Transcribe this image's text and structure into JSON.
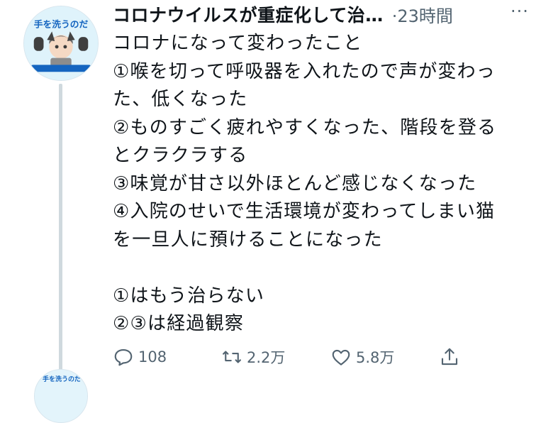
{
  "tweet": {
    "display_name": "コロナウイルスが重症化して治…",
    "time": "·23時間",
    "more_label": "···",
    "lines": [
      "コロナになって変わったこと",
      "①喉を切って呼吸器を入れたので声が変わっ",
      "た、低くなった",
      "②ものすごく疲れやすくなった、階段を登る",
      "とクラクラする",
      "③味覚が甘さ以外ほとんど感じなくなった",
      "④入院のせいで生活環境が変わってしまい猫",
      "を一旦人に預けることになった",
      "",
      "①はもう治らない",
      "②③は経過観察"
    ],
    "avatar_text": "手を洗うのだ",
    "avatar_next_text": "手を洗うのだ",
    "actions": {
      "reply": {
        "icon": "reply-icon",
        "count": "108"
      },
      "retweet": {
        "icon": "retweet-icon",
        "count": "2.2万"
      },
      "like": {
        "icon": "heart-icon",
        "count": "5.8万"
      },
      "share": {
        "icon": "share-icon"
      }
    }
  },
  "colors": {
    "text": "#0f1419",
    "secondary": "#536471",
    "thread_line": "#cfd9de",
    "avatar_bg": "#dff3fb"
  }
}
